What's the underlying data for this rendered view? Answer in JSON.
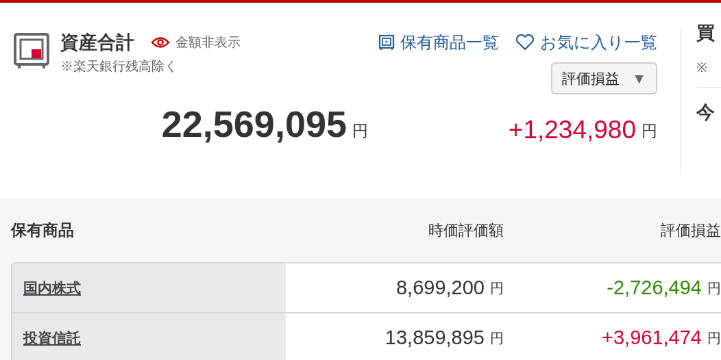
{
  "summary": {
    "title": "資産合計",
    "hide_amount": "金額非表示",
    "note": "※楽天銀行残高除く",
    "links": [
      {
        "kind": "holdings",
        "label": "保有商品一覧"
      },
      {
        "kind": "favorites",
        "label": "お気に入り一覧"
      }
    ],
    "dropdown": {
      "label": "評価損益",
      "caret": "▼"
    },
    "total": {
      "value": "22,569,095",
      "unit": "円"
    },
    "gain": {
      "value": "+1,234,980",
      "unit": "円",
      "color": "#d7003a"
    }
  },
  "side_panel": {
    "heading": "買",
    "note": "※",
    "label": "今"
  },
  "holdings": {
    "title": "保有商品",
    "columns": [
      "時価評価額",
      "評価損益"
    ],
    "rows": [
      {
        "name": "国内株式",
        "value": "8,699,200",
        "value_unit": "円",
        "gain": "-2,726,494",
        "gain_unit": "円",
        "color": "#2e8b00"
      },
      {
        "name": "投資信託",
        "value": "13,859,895",
        "value_unit": "円",
        "gain": "+3,961,474",
        "gain_unit": "円",
        "color": "#d7003a"
      }
    ]
  }
}
